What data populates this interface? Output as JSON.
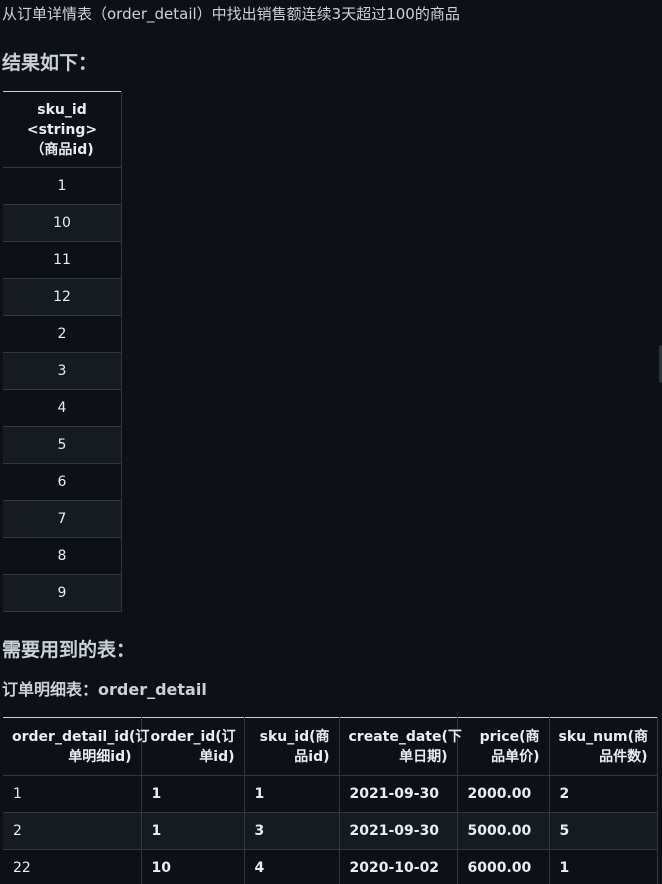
{
  "intro": "从订单详情表（order_detail）中找出销售额连续3天超过100的商品",
  "result_heading": "结果如下：",
  "result_table": {
    "header_lines": [
      "sku_id",
      "<string>",
      "（商品id)"
    ],
    "rows": [
      "1",
      "10",
      "11",
      "12",
      "2",
      "3",
      "4",
      "5",
      "6",
      "7",
      "8",
      "9"
    ]
  },
  "tables_heading": "需要用到的表：",
  "table_label": "订单明细表：order_detail",
  "detail_table": {
    "columns": [
      "order_detail_id(订单明细id)",
      "order_id(订单id)",
      "sku_id(商品id)",
      "create_date(下单日期)",
      "price(商品单价)",
      "sku_num(商品件数)"
    ],
    "rows": [
      [
        "1",
        "1",
        "1",
        "2021-09-30",
        "2000.00",
        "2"
      ],
      [
        "2",
        "1",
        "3",
        "2021-09-30",
        "5000.00",
        "5"
      ],
      [
        "22",
        "10",
        "4",
        "2020-10-02",
        "6000.00",
        "1"
      ]
    ]
  }
}
